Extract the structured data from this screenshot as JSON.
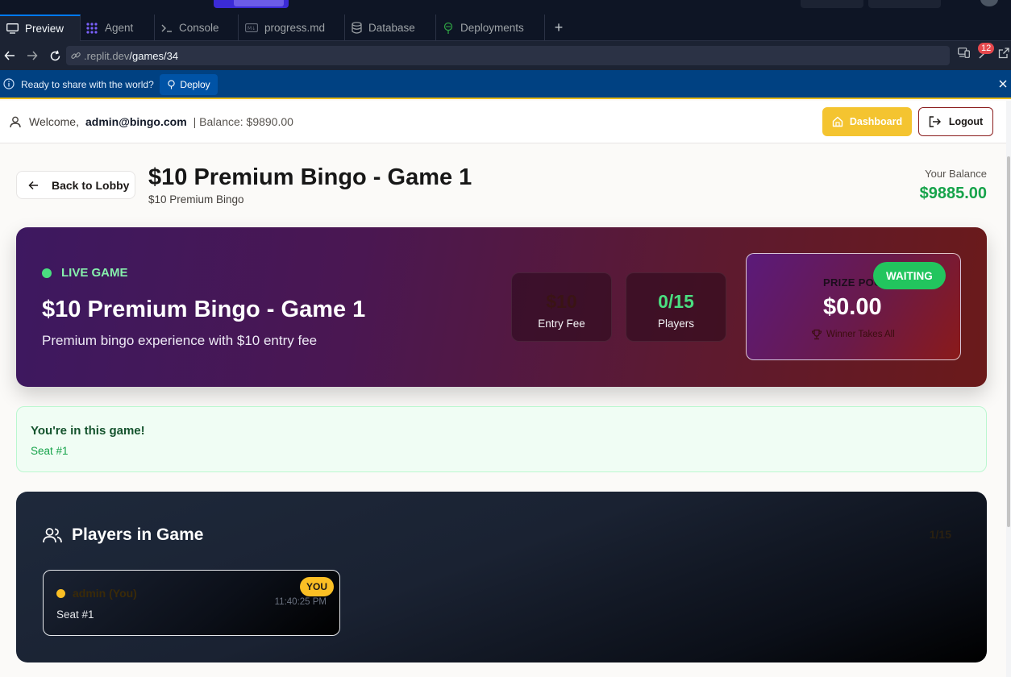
{
  "browser": {
    "tabs": [
      {
        "label": "Preview",
        "icon": "monitor-icon"
      },
      {
        "label": "Agent",
        "icon": "agent-icon"
      },
      {
        "label": "Console",
        "icon": "terminal-icon"
      },
      {
        "label": "progress.md",
        "icon": "markdown-icon"
      },
      {
        "label": "Database",
        "icon": "database-icon"
      },
      {
        "label": "Deployments",
        "icon": "deploy-icon"
      }
    ],
    "add_tab": "+",
    "url_host": ".replit.dev",
    "url_path": "/games/34",
    "notification_count": "12"
  },
  "deploy_banner": {
    "message": "Ready to share with the world?",
    "button": "Deploy"
  },
  "header": {
    "welcome": "Welcome,",
    "email": "admin@bingo.com",
    "balance": "| Balance: $9890.00",
    "dashboard": "Dashboard",
    "logout": "Logout"
  },
  "page": {
    "back": "Back to Lobby",
    "title": "$10 Premium Bingo - Game 1",
    "subtitle": "$10 Premium Bingo",
    "balance_label": "Your Balance",
    "balance_value": "$9885.00"
  },
  "hero": {
    "live": "LIVE GAME",
    "title": "$10 Premium Bingo - Game 1",
    "description": "Premium bingo experience with $10 entry fee",
    "entry_fee_value": "$10",
    "entry_fee_label": "Entry Fee",
    "players_value": "0/15",
    "players_label": "Players",
    "prize_label": "PRIZE POOL",
    "prize_value": "$0.00",
    "prize_sub": "Winner Takes All",
    "status": "WAITING"
  },
  "joined": {
    "title": "You're in this game!",
    "seat": "Seat #1"
  },
  "players": {
    "heading": "Players in Game",
    "count": "1/15",
    "list": [
      {
        "name": "admin (You)",
        "seat": "Seat #1",
        "badge": "YOU",
        "time": "11:40:25 PM"
      }
    ]
  },
  "colors": {
    "accent_green": "#16a34a",
    "dashboard_yellow": "#f4c430",
    "waiting_green": "#22c55e",
    "logout_border": "#8a1c1c"
  }
}
